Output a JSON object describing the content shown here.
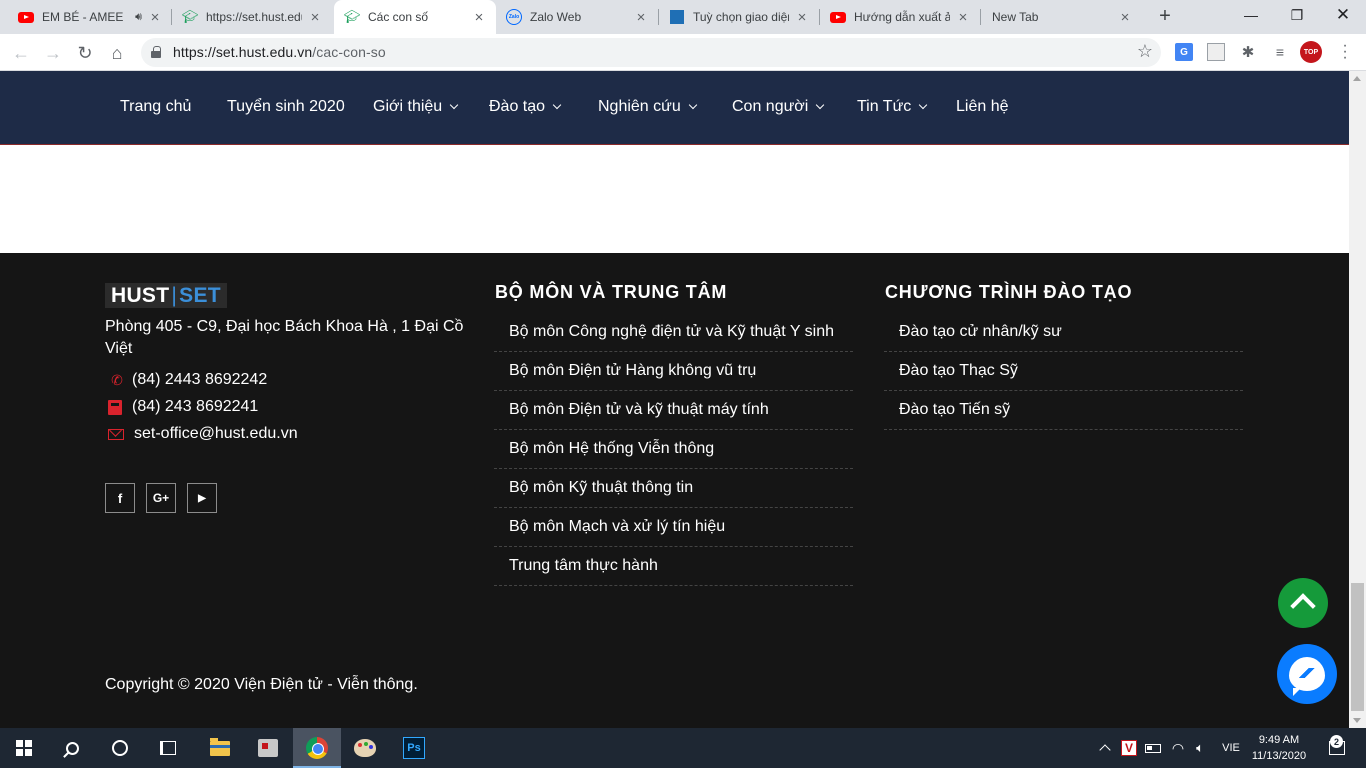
{
  "browser": {
    "tabs": [
      {
        "title": "EM BÉ - AMEE",
        "favicon": "youtube-icon",
        "audio": true,
        "active": false
      },
      {
        "title": "https://set.hust.edu",
        "favicon": "graduation-cap-icon",
        "audio": false,
        "active": false
      },
      {
        "title": "Các con số",
        "favicon": "graduation-cap-icon",
        "audio": false,
        "active": true
      },
      {
        "title": "Zalo Web",
        "favicon": "zalo-icon",
        "audio": false,
        "active": false
      },
      {
        "title": "Tuỳ chọn giao diện",
        "favicon": "chart-icon",
        "audio": false,
        "active": false
      },
      {
        "title": "Hướng dẫn xuất ả",
        "favicon": "youtube-icon",
        "audio": false,
        "active": false
      },
      {
        "title": "New Tab",
        "favicon": "",
        "audio": false,
        "active": false
      }
    ],
    "zalo_mark": "Zalo",
    "url_host": "https://set.hust.edu.vn",
    "url_path": "/cac-con-so",
    "extension_top_label": "TOP"
  },
  "site": {
    "menu": [
      {
        "label": "Trang chủ",
        "dropdown": false
      },
      {
        "label": "Tuyển sinh 2020",
        "dropdown": false
      },
      {
        "label": "Giới thiệu",
        "dropdown": true
      },
      {
        "label": "Đào tạo",
        "dropdown": true
      },
      {
        "label": "Nghiên cứu",
        "dropdown": true
      },
      {
        "label": "Con người",
        "dropdown": true
      },
      {
        "label": "Tin Tức",
        "dropdown": true
      },
      {
        "label": "Liên hệ",
        "dropdown": false
      }
    ],
    "colors": {
      "nav_bg": "#1e2b47",
      "footer_bg": "#151515",
      "accent_red": "#d9232d",
      "logo_blue": "#3b8fd9"
    }
  },
  "footer": {
    "logo": {
      "part1": "HUST",
      "separator": "|",
      "part2": "SET"
    },
    "address": "Phòng 405 - C9, Đại học Bách Khoa Hà , 1 Đại Cồ Việt",
    "phone": "(84) 2443 8692242",
    "fax": "(84) 243 8692241",
    "email": "set-office@hust.edu.vn",
    "social": [
      {
        "name": "facebook-icon",
        "glyph": "f"
      },
      {
        "name": "google-plus-icon",
        "glyph": "G+"
      },
      {
        "name": "youtube-icon",
        "glyph": "▶"
      }
    ],
    "departments_title": "BỘ MÔN VÀ TRUNG TÂM",
    "departments": [
      "Bộ môn Công nghệ điện tử và Kỹ thuật Y sinh",
      "Bộ môn Điện tử Hàng không vũ trụ",
      "Bộ môn Điện tử và kỹ thuật máy tính",
      "Bộ môn Hệ thống Viễn thông",
      "Bộ môn Kỹ thuật thông tin",
      "Bộ môn Mạch và xử lý tín hiệu",
      "Trung tâm thực hành"
    ],
    "programs_title": "CHƯƠNG TRÌNH ĐÀO TẠO",
    "programs": [
      "Đào tạo cử nhân/kỹ sư",
      "Đào tạo Thạc Sỹ",
      "Đào tạo Tiến sỹ"
    ],
    "copyright": "Copyright © 2020 Viện Điện tử - Viễn thông."
  },
  "taskbar": {
    "ps_label": "Ps",
    "tray_v_label": "V",
    "language": "VIE",
    "time": "9:49 AM",
    "date": "11/13/2020",
    "notifications": "2"
  }
}
